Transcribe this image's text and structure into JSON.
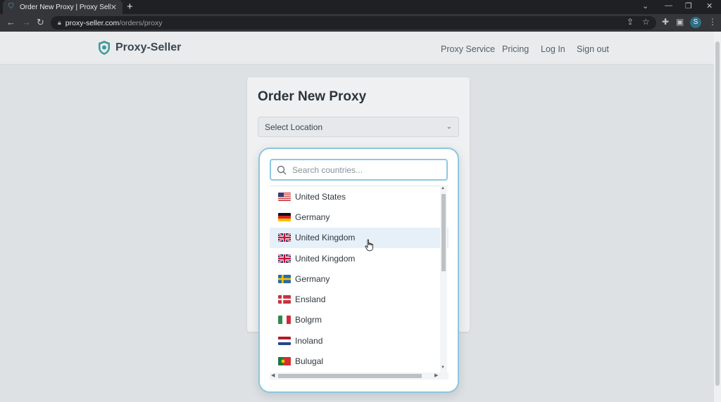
{
  "browser": {
    "tab_title": "Order New Proxy | Proxy Seller",
    "url_host": "proxy-seller.com",
    "url_path": "/orders/proxy",
    "profile_initial": "S"
  },
  "header": {
    "logo_text": "Proxy-Seller",
    "nav": [
      "Proxy Service",
      "Pricing",
      "Log In",
      "Sign out"
    ]
  },
  "card": {
    "title": "Order New Proxy",
    "select_label": "Select Location"
  },
  "dropdown": {
    "search_placeholder": "Search countries...",
    "items": [
      {
        "label": "United States",
        "flag": "us"
      },
      {
        "label": "Germany",
        "flag": "de"
      },
      {
        "label": "United Kingdom",
        "flag": "uk"
      },
      {
        "label": "United Kingdom",
        "flag": "uk"
      },
      {
        "label": "Germany",
        "flag": "se"
      },
      {
        "label": "Ensland",
        "flag": "dk"
      },
      {
        "label": "Bolgrm",
        "flag": "it"
      },
      {
        "label": "Inoland",
        "flag": "nl"
      },
      {
        "label": "Bulugal",
        "flag": "pt"
      }
    ],
    "hovered_index": 2
  },
  "colors": {
    "accent": "#8ec6df",
    "hover_row": "#e6f0f8",
    "logo_shield": "#3f9a9a"
  }
}
